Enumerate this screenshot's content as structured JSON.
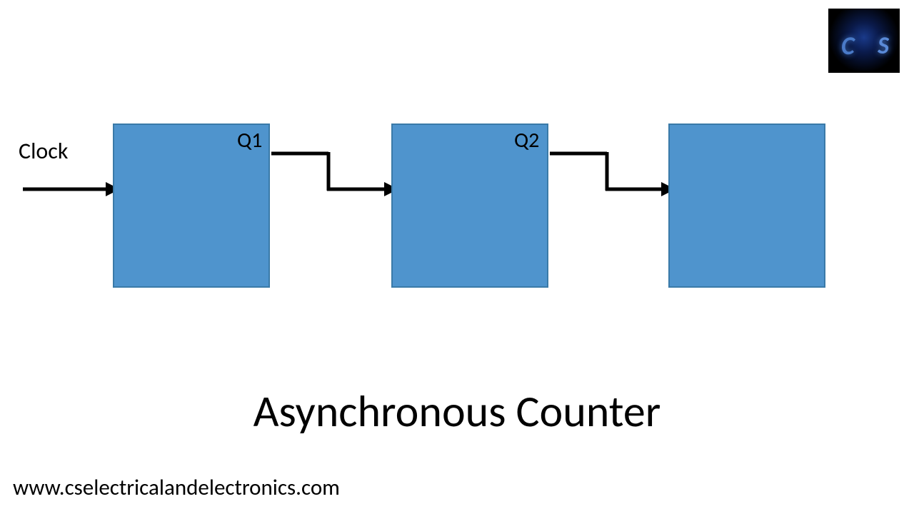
{
  "diagram": {
    "clock_label": "Clock",
    "blocks": [
      {
        "output_label": "Q1"
      },
      {
        "output_label": "Q2"
      },
      {
        "output_label": ""
      }
    ],
    "block_color": "#4f94cd",
    "block_border": "#3a7aa8"
  },
  "title": "Asynchronous Counter",
  "website": "www.cselectricalandelectronics.com",
  "logo": {
    "letter1": "C",
    "letter2": "S"
  }
}
